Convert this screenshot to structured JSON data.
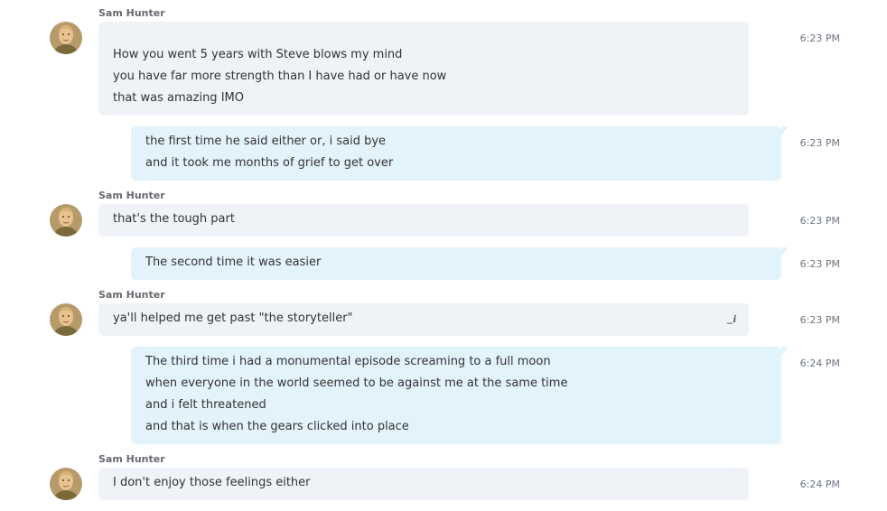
{
  "messages": [
    {
      "sender": "Sam Hunter",
      "direction": "in",
      "time": "6:23 PM",
      "lines": [
        "How you went 5 years with Steve blows my mind",
        "you have far more strength than I have had or have now",
        "that was amazing IMO"
      ]
    },
    {
      "direction": "out",
      "time": "6:23 PM",
      "lines": [
        "the first time he said either or, i said bye",
        "and it took me months of grief to get over"
      ]
    },
    {
      "sender": "Sam Hunter",
      "direction": "in",
      "time": "6:23 PM",
      "lines": [
        "that's the tough part"
      ]
    },
    {
      "direction": "out",
      "time": "6:23 PM",
      "lines": [
        "The second time it was easier"
      ]
    },
    {
      "sender": "Sam Hunter",
      "direction": "in",
      "time": "6:23 PM",
      "edited_mark": "_i",
      "lines": [
        "ya'll helped me get past \"the storyteller\""
      ]
    },
    {
      "direction": "out",
      "time": "6:24 PM",
      "lines": [
        "The third time i had a monumental episode screaming to a full moon",
        "when everyone in the world seemed to be against me at the same time",
        "and i felt threatened",
        "and that is when the gears clicked into place"
      ]
    },
    {
      "sender": "Sam Hunter",
      "direction": "in",
      "time": "6:24 PM",
      "lines": [
        "I don't enjoy those feelings either"
      ]
    }
  ],
  "colors": {
    "incoming_bubble": "#eff2f7",
    "outgoing_bubble": "#e3f3fb",
    "timestamp": "#6d7580",
    "sender_name": "#666a70"
  }
}
